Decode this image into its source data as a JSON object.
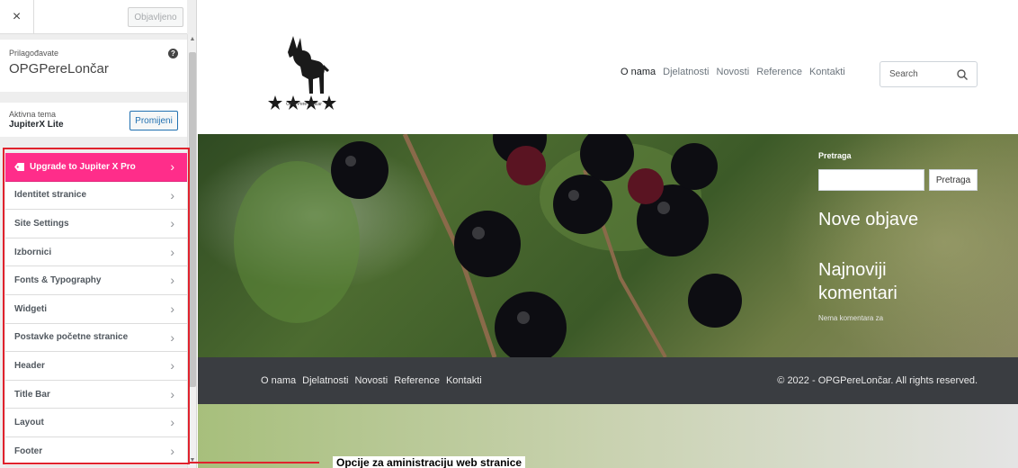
{
  "sidebar": {
    "close_label": "×",
    "publish_label": "Objavljeno",
    "customizing_label": "Prilagođavate",
    "site_name": "OPGPereLončar",
    "help_icon": "question-circle-icon",
    "active_theme_label": "Aktivna tema",
    "theme_name": "JupiterX Lite",
    "change_label": "Promijeni",
    "items": [
      {
        "label": "Upgrade to Jupiter X Pro",
        "icon": "tag-icon",
        "highlight": true
      },
      {
        "label": "Identitet stranice"
      },
      {
        "label": "Site Settings"
      },
      {
        "label": "Izbornici"
      },
      {
        "label": "Fonts & Typography"
      },
      {
        "label": "Widgeti"
      },
      {
        "label": "Postavke početne stranice"
      },
      {
        "label": "Header"
      },
      {
        "label": "Title Bar"
      },
      {
        "label": "Layout"
      },
      {
        "label": "Footer"
      }
    ],
    "chevron": "›",
    "accent_color": "#ff2d8a"
  },
  "site": {
    "logo_caption": "OPG Pere Lončar",
    "nav": [
      "O nama",
      "Djelatnosti",
      "Novosti",
      "Reference",
      "Kontakti"
    ],
    "search_placeholder": "Search",
    "widget_search_label": "Pretraga",
    "widget_search_button": "Pretraga",
    "recent_posts_title": "Nove objave",
    "recent_comments_title": "Najnoviji komentari",
    "no_comments": "Nema komentara za",
    "footer_nav": [
      "O nama",
      "Djelatnosti",
      "Novosti",
      "Reference",
      "Kontakti"
    ],
    "copyright": "© 2022 - OPGPereLončar. All rights reserved."
  },
  "annotation": {
    "caption": "Opcije za aministraciju web stranice",
    "color": "#e0222d"
  }
}
